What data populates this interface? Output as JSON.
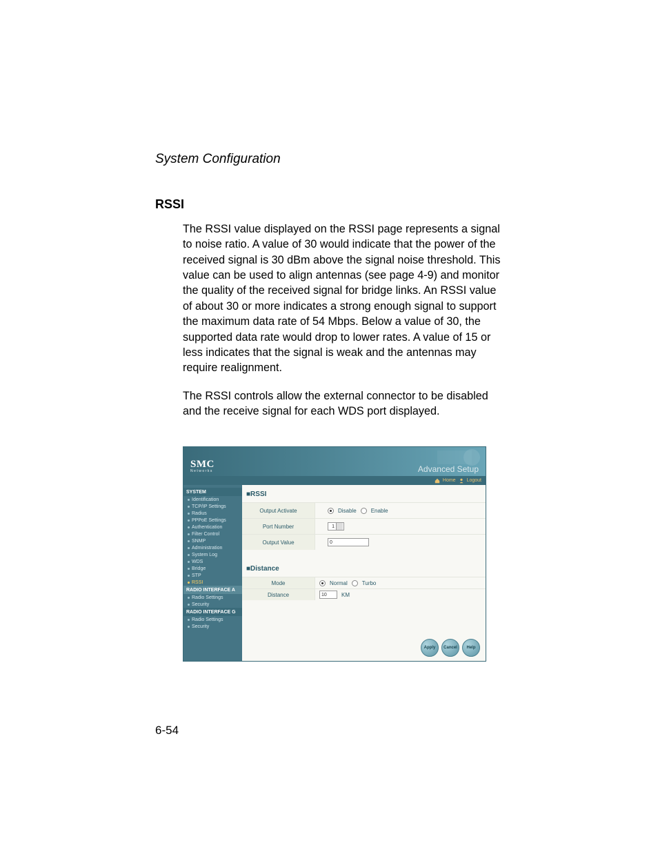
{
  "doc": {
    "section_header": "System Configuration",
    "heading": "RSSI",
    "para1": "The RSSI value displayed on the RSSI page represents a signal to noise ratio. A value of 30 would indicate that the power of the received signal is 30 dBm above the signal noise threshold. This value can be used to align antennas (see page 4-9) and monitor the quality of the received signal for bridge links. An RSSI value of about 30 or more indicates a strong enough signal to support the maximum data rate of 54 Mbps. Below a value of 30, the supported data rate would drop to lower rates. A value of 15 or less indicates that the signal is weak and the antennas may require realignment.",
    "para2": "The RSSI controls allow the external connector to be disabled and the receive signal for each WDS port displayed.",
    "page_number": "6-54"
  },
  "app": {
    "logo": {
      "main": "SMC",
      "sub": "Networks"
    },
    "topbar_title": "Advanced Setup",
    "tabs": {
      "home": "Home",
      "logout": "Logout"
    },
    "sidebar": {
      "group_system": "SYSTEM",
      "items_system": [
        "Identification",
        "TCP/IP Settings",
        "Radius",
        "PPPoE Settings",
        "Authentication",
        "Filter Control",
        "SNMP",
        "Administration",
        "System Log",
        "WDS",
        "Bridge",
        "STP",
        "RSSI"
      ],
      "group_radio_a": "RADIO INTERFACE A",
      "items_radio_a": [
        "Radio Settings",
        "Security"
      ],
      "group_radio_g": "RADIO INTERFACE G",
      "items_radio_g": [
        "Radio Settings",
        "Security"
      ]
    },
    "panels": {
      "rssi": {
        "title": "RSSI",
        "output_activate": {
          "label": "Output Activate",
          "disable": "Disable",
          "enable": "Enable",
          "selected": "disable"
        },
        "port_number": {
          "label": "Port Number",
          "value": "1"
        },
        "output_value": {
          "label": "Output Value",
          "value": "0"
        }
      },
      "distance": {
        "title": "Distance",
        "mode": {
          "label": "Mode",
          "normal": "Normal",
          "turbo": "Turbo",
          "selected": "normal"
        },
        "distance": {
          "label": "Distance",
          "value": "10",
          "unit": "KM"
        }
      }
    },
    "buttons": {
      "apply": "Apply",
      "cancel": "Cancel",
      "help": "Help"
    }
  }
}
